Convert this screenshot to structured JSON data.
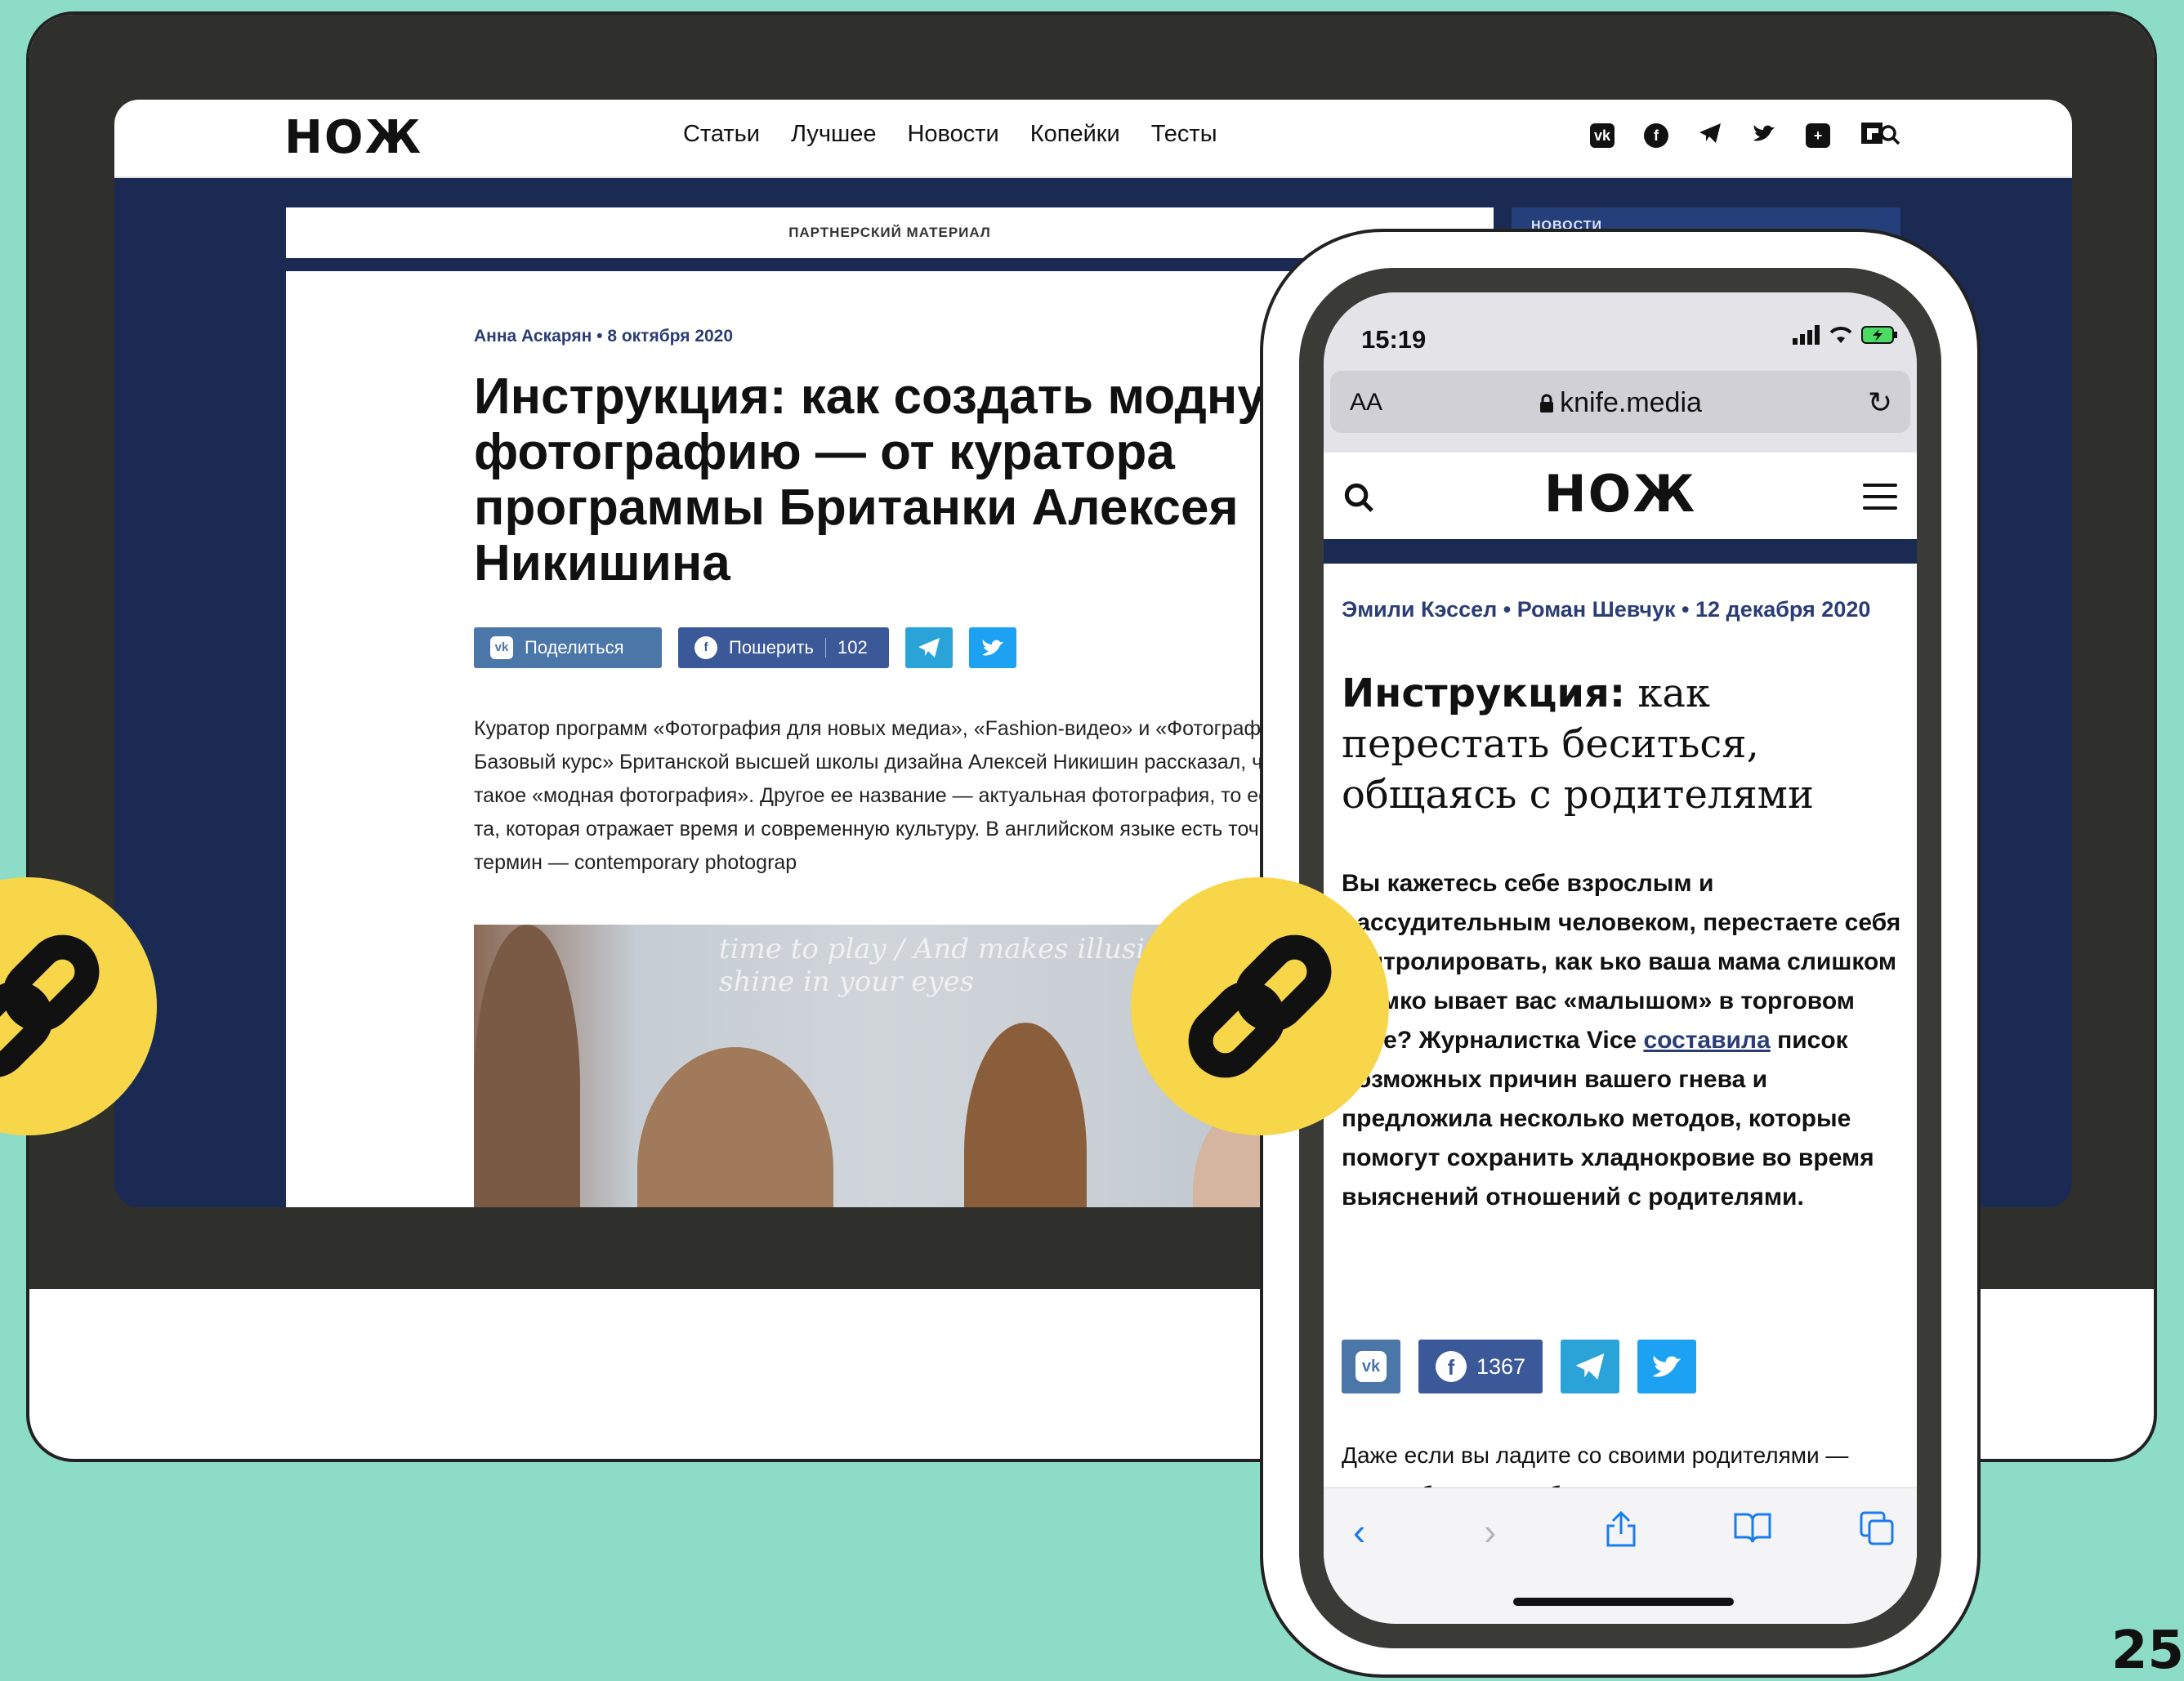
{
  "desktop": {
    "logo": "НОЖ",
    "menu": [
      "Статьи",
      "Лучшее",
      "Новости",
      "Копейки",
      "Тесты"
    ],
    "social_icons": [
      "vk-icon",
      "facebook-icon",
      "telegram-icon",
      "twitter-icon",
      "plus-icon",
      "flipboard-icon"
    ],
    "partner_label": "ПАРТНЕРСКИЙ МАТЕРИАЛ",
    "news_label": "НОВОСТИ",
    "meta": "Анна Аскарян  •  8 октября 2020",
    "title": "Инструкция: как создать модную фотографию — от куратора программы Британки Алексея Никишина",
    "share": {
      "vk_label": "Поделиться",
      "fb_label": "Пошерить",
      "fb_count": "102"
    },
    "body": "Куратор программ «Фотография для новых медиа», «Fashion-видео» и «Фотография. Базовый курс» Британской высшей школы дизайна Алексей Никишин рассказал, что такое «модная фотография». Другое ее название — актуальная фотография, то есть та, которая отражает время и современную культуру. В английском языке есть точный термин — contemporary photograp",
    "photo_caption": "time to play / And makes illusions, always, to / shine in your eyes"
  },
  "phone": {
    "time": "15:19",
    "aa": "AA",
    "url": "knife.media",
    "logo": "НОЖ",
    "meta": "Эмили Кэссел  •  Роман Шевчук  •  12 декабря 2020",
    "title_bold": "Инструкция:",
    "title_rest": " как перестать беситься, общаясь с родителями",
    "lead_before": "Вы кажетесь себе взрослым и рассудительным человеком, перестаете себя контролировать, как ько ваша мама слишком громко ывает вас «малышом» в торговом нтре? Журналистка Vice ",
    "lead_link": "составила",
    "lead_after": " писок возможных причин вашего гнева и предложила несколько методов, которые помогут сохранить хладнокровие во время выяснений отношений с родителями.",
    "fb_count": "1367",
    "body2": "Даже если вы ладите со своими родителями — часто общаетесь, обмениваетесь рецептами и догадками"
  },
  "page_number": "25",
  "colors": {
    "background": "#8ddcc7",
    "navy": "#1b2a52",
    "accent_yellow": "#f7d64a"
  }
}
